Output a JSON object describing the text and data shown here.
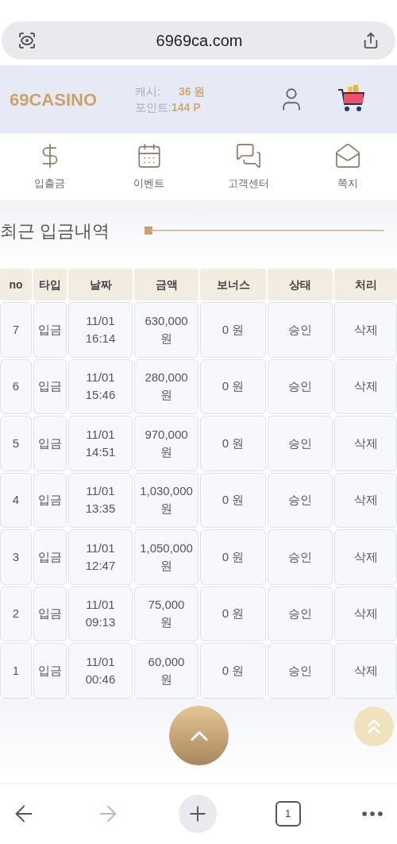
{
  "url_bar": {
    "url": "6969ca.com"
  },
  "header": {
    "logo": "69CASINO",
    "cash_label": "캐시:",
    "cash_value": "36 원",
    "point_label": "포인트:",
    "point_value": "144 P"
  },
  "nav": [
    {
      "kind": "dollar",
      "label": "입출금"
    },
    {
      "kind": "calendar",
      "label": "이벤트"
    },
    {
      "kind": "chat",
      "label": "고객센터"
    },
    {
      "kind": "mail",
      "label": "쪽지"
    }
  ],
  "section_title": "최근 입금내역",
  "table": {
    "columns": [
      "no",
      "타입",
      "날짜",
      "금액",
      "보너스",
      "상태",
      "처리"
    ],
    "rows": [
      [
        "7",
        "입금",
        "11/01\n16:14",
        "630,000\n원",
        "0 원",
        "승인",
        "삭제"
      ],
      [
        "6",
        "입금",
        "11/01\n15:46",
        "280,000\n원",
        "0 원",
        "승인",
        "삭제"
      ],
      [
        "5",
        "입금",
        "11/01\n14:51",
        "970,000\n원",
        "0 원",
        "승인",
        "삭제"
      ],
      [
        "4",
        "입금",
        "11/01\n13:35",
        "1,030,000\n원",
        "0 원",
        "승인",
        "삭제"
      ],
      [
        "3",
        "입금",
        "11/01\n12:47",
        "1,050,000\n원",
        "0 원",
        "승인",
        "삭제"
      ],
      [
        "2",
        "입금",
        "11/01\n09:13",
        "75,000\n원",
        "0 원",
        "승인",
        "삭제"
      ],
      [
        "1",
        "입금",
        "11/01\n00:46",
        "60,000\n원",
        "0 원",
        "승인",
        "삭제"
      ]
    ]
  },
  "browser_toolbar": {
    "back_disabled": false,
    "forward_disabled": true,
    "tab_count": "1"
  }
}
